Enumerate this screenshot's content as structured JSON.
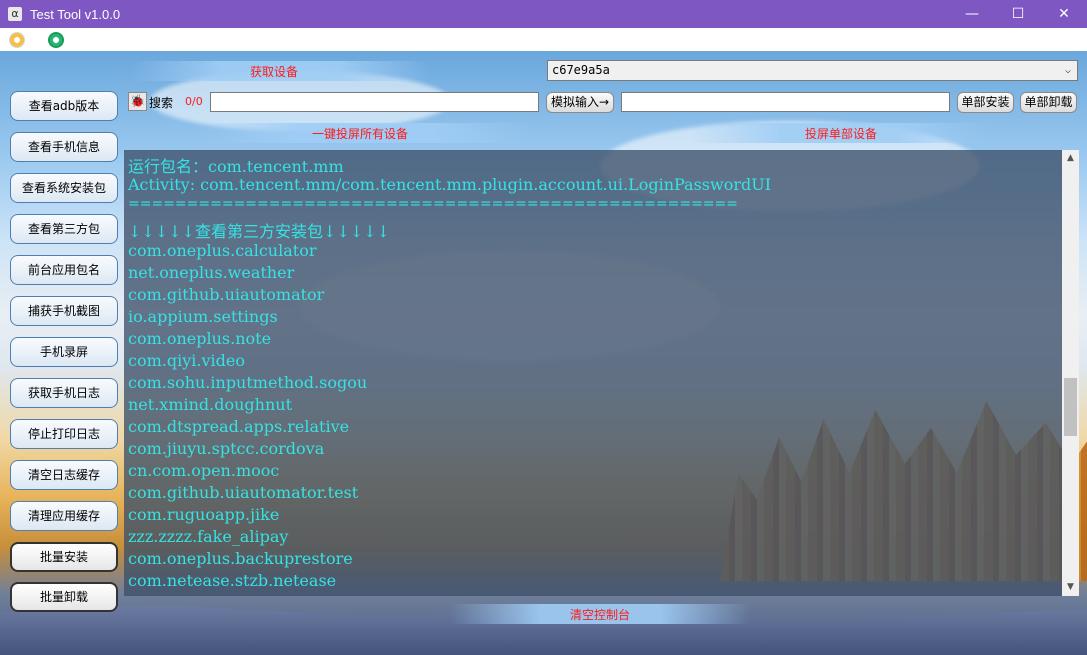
{
  "window": {
    "title": "Test Tool v1.0.0",
    "app_icon_glyph": "α",
    "minimize": "—",
    "maximize": "☐",
    "close": "✕"
  },
  "toolbar": {
    "icons": [
      "refresh-icon",
      "settings-icon"
    ]
  },
  "top": {
    "get_device_label": "获取设备",
    "device_selected": "c67e9a5a",
    "search_label": "搜索",
    "search_count": "0/0",
    "search_value": "",
    "simulate_input_label": "模拟输入→",
    "simulate_input_value": "",
    "single_install_label": "单部安装",
    "single_uninstall_label": "单部卸载",
    "mirror_all_label": "一键投屏所有设备",
    "mirror_single_label": "投屏单部设备"
  },
  "sidebar": {
    "items": [
      "查看adb版本",
      "查看手机信息",
      "查看系统安装包",
      "查看第三方包",
      "前台应用包名",
      "捕获手机截图",
      "手机录屏",
      "获取手机日志",
      "停止打印日志",
      "清空日志缓存",
      "清理应用缓存",
      "批量安装",
      "批量卸载"
    ]
  },
  "console": {
    "lines": [
      "运行包名：com.tencent.mm",
      "Activity: com.tencent.mm/com.tencent.mm.plugin.account.ui.LoginPasswordUI",
      "====================================================",
      "↓↓↓↓↓查看第三方安装包↓↓↓↓↓",
      "com.oneplus.calculator",
      "net.oneplus.weather",
      "com.github.uiautomator",
      "io.appium.settings",
      "com.oneplus.note",
      "com.qiyi.video",
      "com.sohu.inputmethod.sogou",
      "net.xmind.doughnut",
      "com.dtspread.apps.relative",
      "com.jiuyu.sptcc.cordova",
      "cn.com.open.mooc",
      "com.github.uiautomator.test",
      "com.ruguoapp.jike",
      "zzz.zzzz.fake_alipay",
      "com.oneplus.backuprestore",
      "com.netease.stzb.netease"
    ],
    "clear_label": "清空控制台"
  }
}
